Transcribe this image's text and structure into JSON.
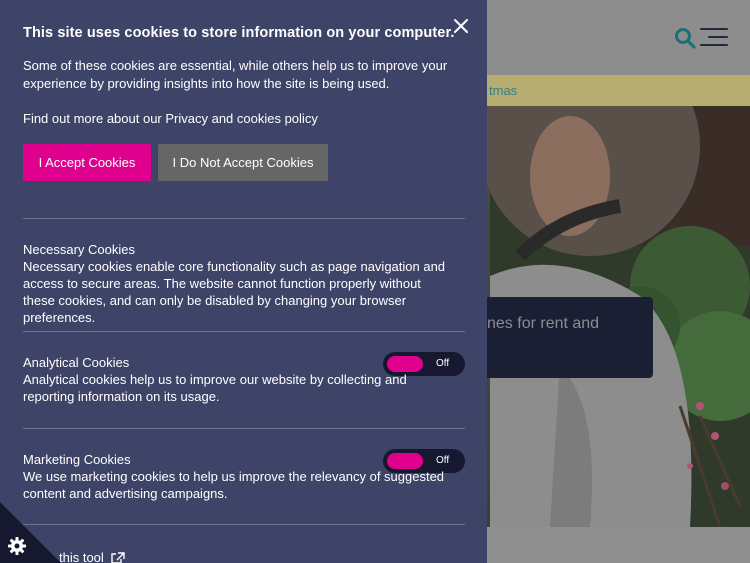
{
  "site": {
    "banner_text": "tmas",
    "hero_card_text": "nes for rent and"
  },
  "cookie_panel": {
    "title": "This site uses cookies to store information on your computer.",
    "intro": "Some of these cookies are essential, while others help us to improve your experience by providing insights into how the site is being used.",
    "policy_line": "Find out more about our Privacy and cookies policy",
    "accept_label": "I Accept Cookies",
    "decline_label": "I Do Not Accept Cookies",
    "sections": [
      {
        "title": "Necessary Cookies",
        "description": "Necessary cookies enable core functionality such as page navigation and access to secure areas. The website cannot function properly without these cookies, and can only be disabled by changing your browser preferences."
      },
      {
        "title": "Analytical Cookies",
        "description": "Analytical cookies help us to improve our website by collecting and reporting information on its usage.",
        "toggle_label": "Off"
      },
      {
        "title": "Marketing Cookies",
        "description": "We use marketing cookies to help us improve the relevancy of suggested content and advertising campaigns.",
        "toggle_label": "Off"
      }
    ],
    "tool_link": "this tool"
  },
  "colors": {
    "panel_bg": "#3e4468",
    "accent": "#e0008e",
    "decline_button": "#666666",
    "toggle_track": "#15182e"
  },
  "icons": [
    "search-icon",
    "menu-icon",
    "close-icon",
    "gear-icon",
    "external-link-icon"
  ]
}
